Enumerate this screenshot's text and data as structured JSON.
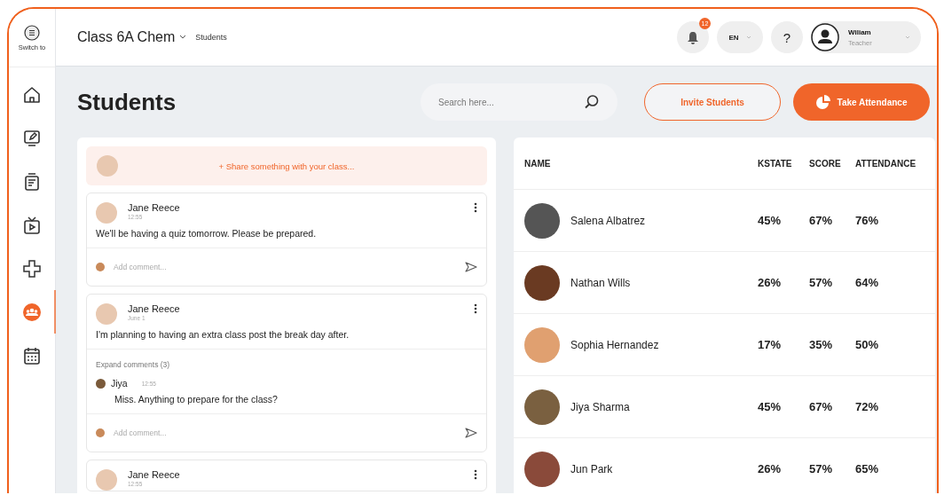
{
  "sidebar": {
    "switch_label": "Switch to",
    "items": [
      {
        "kind": "home",
        "selected": false
      },
      {
        "kind": "monitor",
        "selected": false
      },
      {
        "kind": "clipboard",
        "selected": false
      },
      {
        "kind": "tv",
        "selected": false
      },
      {
        "kind": "gamepad",
        "selected": false
      },
      {
        "kind": "people",
        "selected": true
      },
      {
        "kind": "calendar",
        "selected": false
      }
    ]
  },
  "topbar": {
    "class_name": "Class 6A Chem",
    "breadcrumb": "Students",
    "notification_count": "12",
    "language": "EN",
    "help": "?",
    "user": {
      "name": "Wiliam",
      "role": "Teacher"
    }
  },
  "page_title": "Students",
  "search": {
    "placeholder": "Search here..."
  },
  "buttons": [
    {
      "label": "Invite Students",
      "kind": "outline"
    },
    {
      "label": "Take Attendance",
      "kind": "filled"
    }
  ],
  "feed": {
    "share_prompt": "+ Share something with your class...",
    "posts": [
      {
        "author": "Jane Reece",
        "time": "12:55",
        "text": "We'll be having a quiz tomorrow. Please be prepared.",
        "comment_placeholder": "Add comment..."
      },
      {
        "author": "Jane Reece",
        "time": "June 1",
        "text": "I'm planning to having an extra class post the break day after.",
        "expand_label": "Expand comments (3)",
        "comments": [
          {
            "author": "Jiya",
            "time": "12:55",
            "text": "Miss. Anything to prepare for the class?"
          }
        ],
        "comment_placeholder": "Add comment..."
      },
      {
        "author": "Jane Reece",
        "time": "12:55"
      }
    ]
  },
  "table": {
    "columns": [
      "NAME",
      "KSTATE",
      "SCORE",
      "ATTENDANCE"
    ],
    "rows": [
      {
        "name": "Salena Albatrez",
        "kstate": "45%",
        "score": "67%",
        "attendance": "76%"
      },
      {
        "name": "Nathan Wills",
        "kstate": "26%",
        "score": "57%",
        "attendance": "64%"
      },
      {
        "name": "Sophia Hernandez",
        "kstate": "17%",
        "score": "35%",
        "attendance": "50%"
      },
      {
        "name": "Jiya Sharma",
        "kstate": "45%",
        "score": "67%",
        "attendance": "72%"
      },
      {
        "name": "Jun Park",
        "kstate": "26%",
        "score": "57%",
        "attendance": "65%"
      }
    ]
  }
}
